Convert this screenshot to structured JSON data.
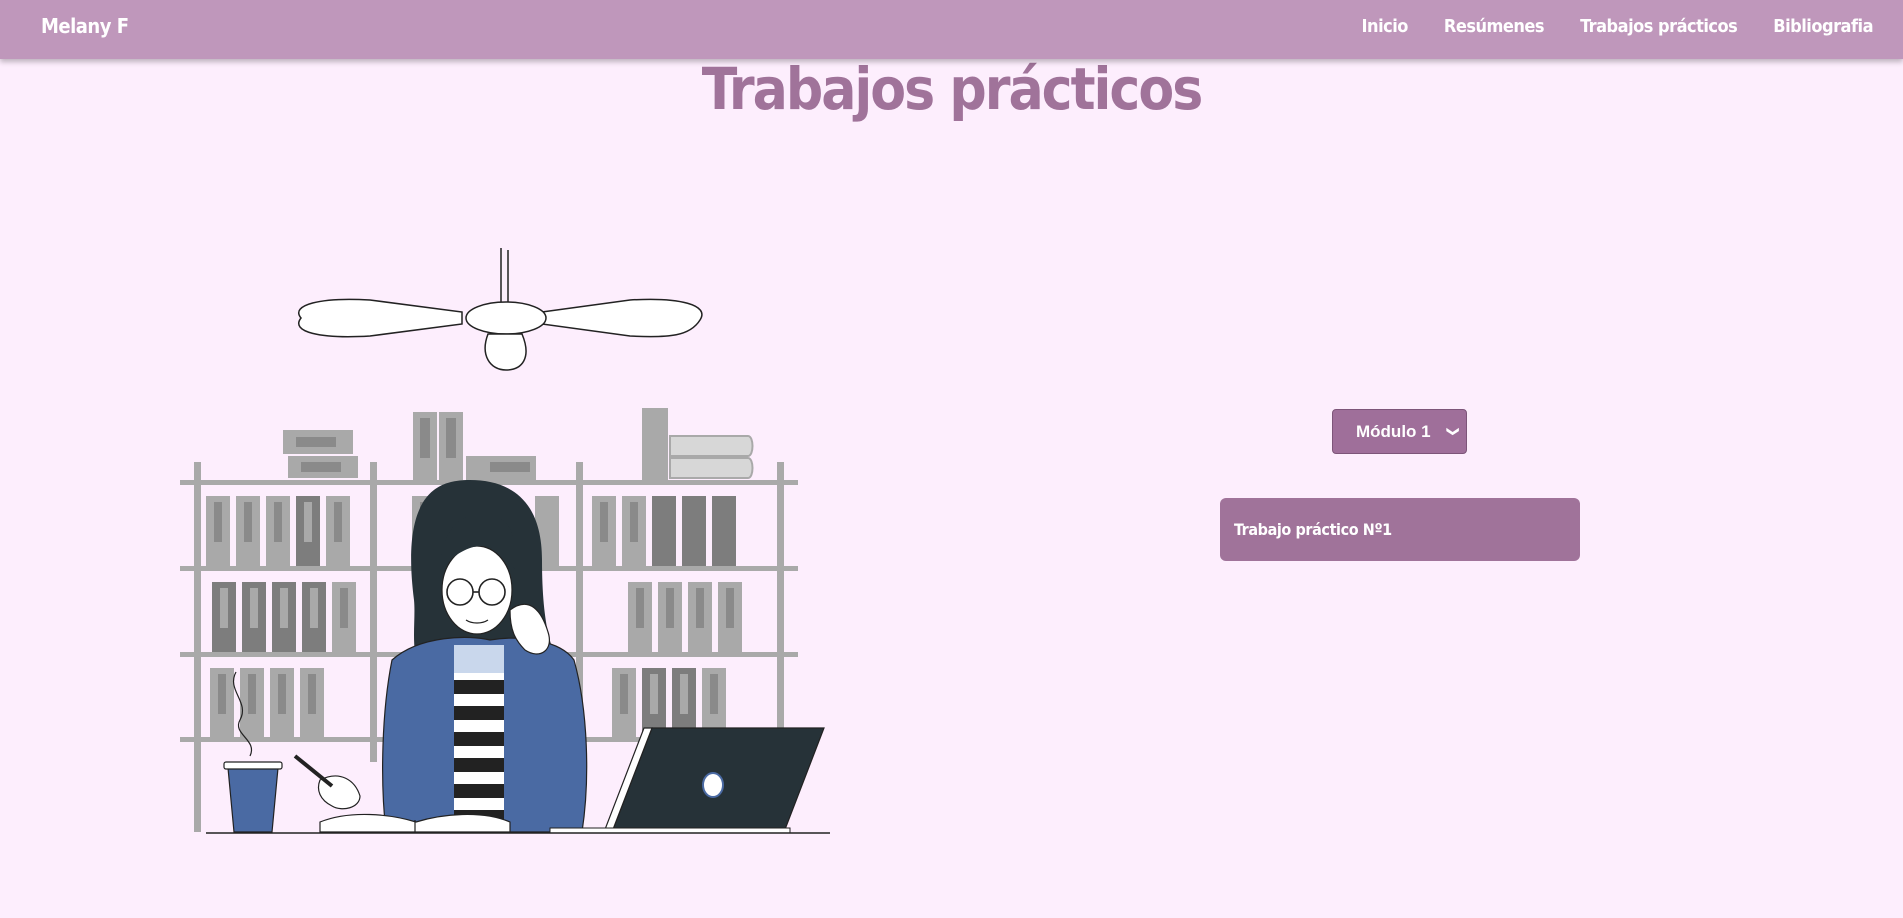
{
  "navbar": {
    "brand": "Melany F",
    "links": [
      {
        "label": "Inicio"
      },
      {
        "label": "Resúmenes"
      },
      {
        "label": "Trabajos prácticos"
      },
      {
        "label": "Bibliografia"
      }
    ]
  },
  "page": {
    "title": "Trabajos prácticos"
  },
  "module_select": {
    "selected": "Módulo 1"
  },
  "assignments": [
    {
      "label": "Trabajo práctico Nº1"
    }
  ],
  "colors": {
    "navbar_bg": "#bf97bb",
    "page_bg": "#fdeefd",
    "accent": "#a0739a",
    "denim": "#4a6aa3",
    "laptop": "#263238",
    "shelf": "#a9a9a9"
  },
  "illustration": {
    "subject": "student-studying-illustration"
  }
}
